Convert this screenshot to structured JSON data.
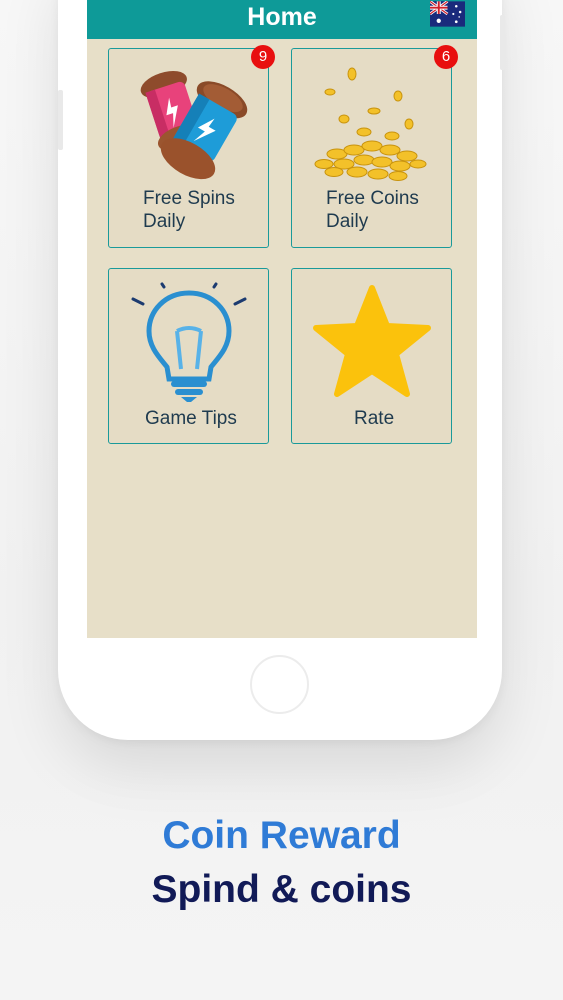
{
  "header": {
    "title": "Home",
    "flag_icon": "australia-flag-icon"
  },
  "cards": [
    {
      "label_line1": "Free Spins",
      "label_line2": "Daily",
      "badge": "9",
      "icon": "spin-capsules-icon"
    },
    {
      "label_line1": "Free Coins",
      "label_line2": "Daily",
      "badge": "6",
      "icon": "gold-coins-icon"
    },
    {
      "label_line1": "Game Tips",
      "icon": "lightbulb-icon"
    },
    {
      "label_line1": "Rate",
      "icon": "star-icon"
    }
  ],
  "caption": {
    "line1": "Coin Reward",
    "line2": "Spind & coins"
  },
  "colors": {
    "header": "#0e9a98",
    "screen_bg": "#e7dfc8",
    "badge": "#e80f0f",
    "caption1": "#2f7bd6",
    "caption2": "#111a57",
    "star": "#fbc20c"
  }
}
